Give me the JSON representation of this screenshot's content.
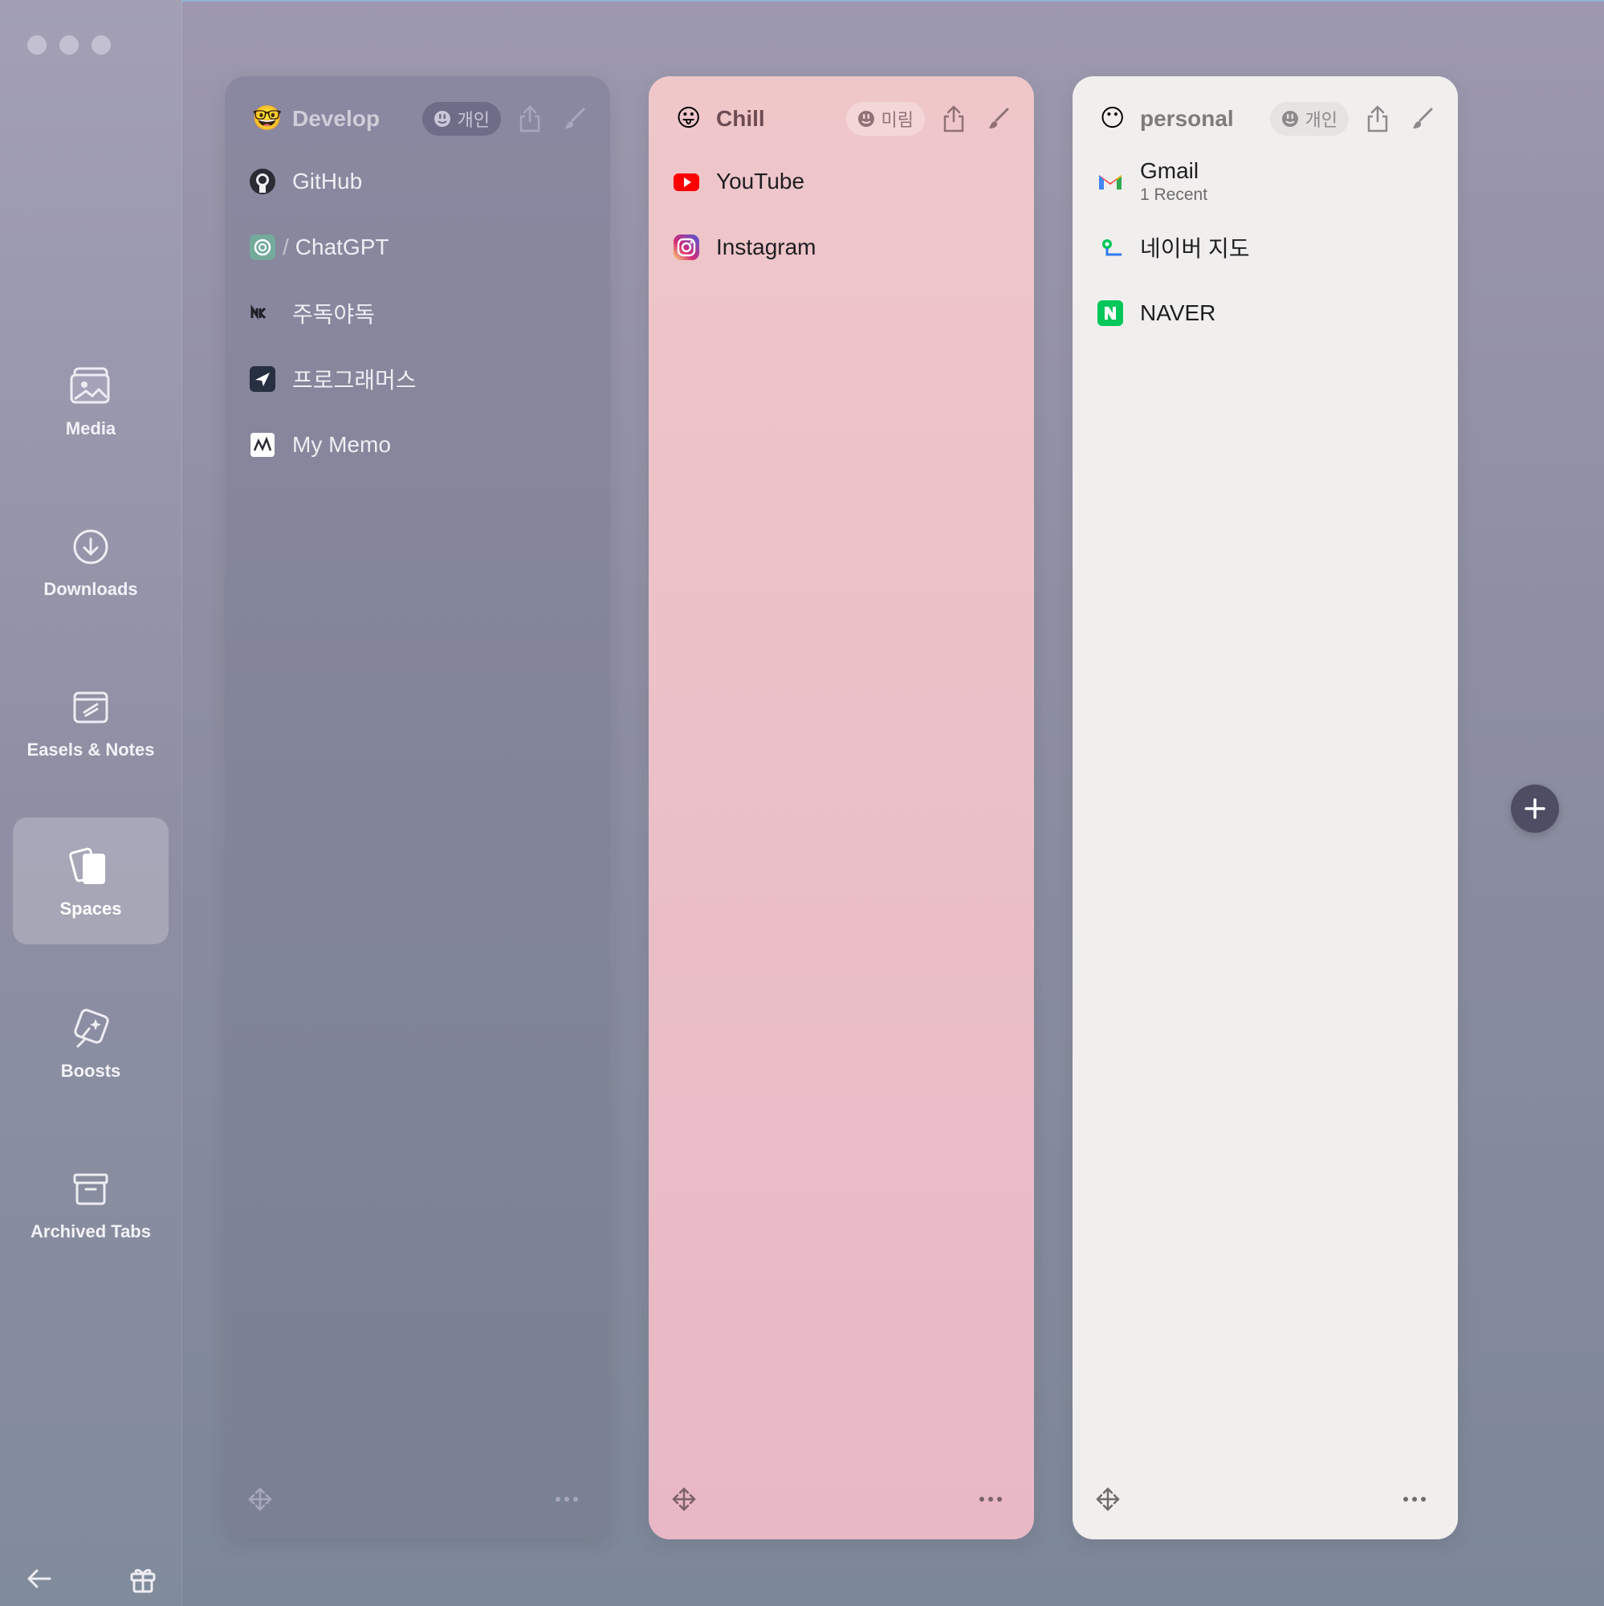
{
  "sidebar": {
    "items": [
      {
        "label": "Media",
        "icon": "media-icon"
      },
      {
        "label": "Downloads",
        "icon": "download-icon"
      },
      {
        "label": "Easels & Notes",
        "icon": "easel-icon"
      },
      {
        "label": "Spaces",
        "icon": "spaces-icon",
        "active": true
      },
      {
        "label": "Boosts",
        "icon": "boost-icon"
      },
      {
        "label": "Archived Tabs",
        "icon": "archive-icon"
      }
    ],
    "bottom": {
      "back_icon": "arrow-left-icon",
      "gift_icon": "gift-icon"
    }
  },
  "spaces": [
    {
      "title": "Develop",
      "emoji": "🤓",
      "profile": "개인",
      "tabs": [
        {
          "label": "GitHub",
          "icon": "github-icon"
        },
        {
          "label": "ChatGPT",
          "icon": "chatgpt-icon",
          "prefix": "/"
        },
        {
          "label": "주독야독",
          "icon": "nk-icon"
        },
        {
          "label": "프로그래머스",
          "icon": "programmers-icon"
        },
        {
          "label": "My Memo",
          "icon": "memo-icon"
        }
      ]
    },
    {
      "title": "Chill",
      "emoji": "😛",
      "profile": "미림",
      "tabs": [
        {
          "label": "YouTube",
          "icon": "youtube-icon"
        },
        {
          "label": "Instagram",
          "icon": "instagram-icon"
        }
      ]
    },
    {
      "title": "personal",
      "emoji": "😶",
      "profile": "개인",
      "tabs": [
        {
          "label": "Gmail",
          "sub": "1 Recent",
          "icon": "gmail-icon"
        },
        {
          "label": "네이버 지도",
          "icon": "naver-map-icon"
        },
        {
          "label": "NAVER",
          "icon": "naver-icon"
        }
      ]
    }
  ],
  "colors": {
    "chill_card": "#efc7c9",
    "personal_card": "#f1efee",
    "develop_card": "#8a88a0",
    "add_button": "#4d4e64"
  }
}
